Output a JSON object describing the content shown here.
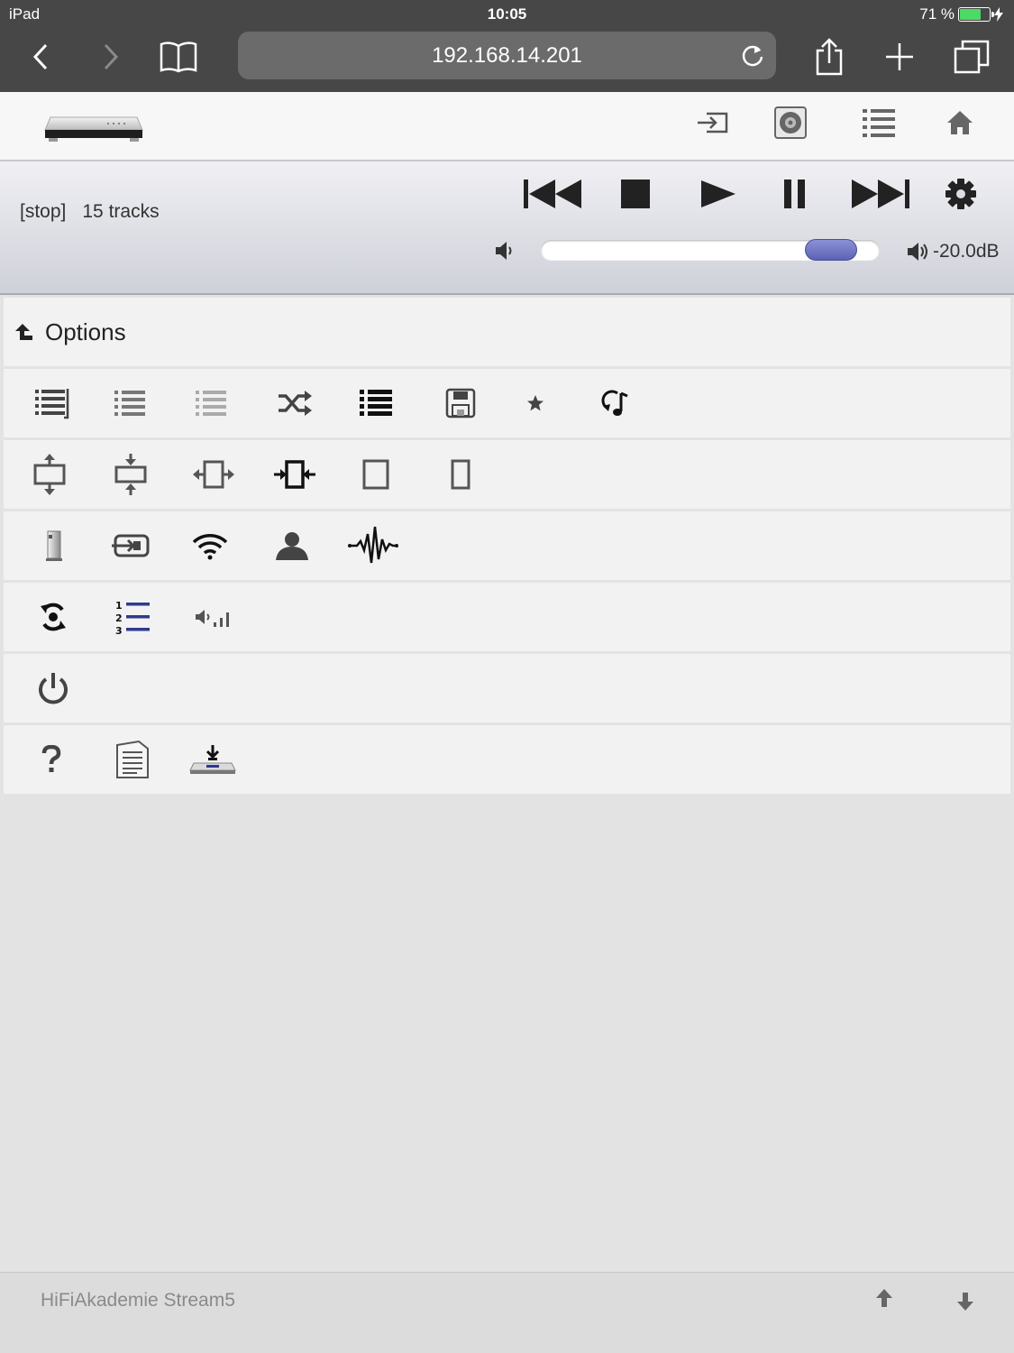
{
  "status_bar": {
    "device": "iPad",
    "time": "10:05",
    "battery": "71 %",
    "battery_level": 0.71
  },
  "safari": {
    "url": "192.168.14.201"
  },
  "player": {
    "state": "[stop]",
    "tracks": "15 tracks",
    "volume_db": "-20.0dB",
    "volume_level": 0.92
  },
  "options": {
    "title": "Options"
  },
  "footer": {
    "title": "HiFiAkademie Stream5"
  },
  "colors": {
    "accent": "#5c63b5",
    "toolbar_bg": "#474747",
    "battery": "#4cd964"
  },
  "icons": {
    "safari": [
      "back-icon",
      "forward-icon",
      "bookmarks-icon",
      "reload-icon",
      "share-icon",
      "new-tab-icon",
      "tabs-icon"
    ],
    "app_top": [
      "input-icon",
      "disc-icon",
      "list-icon",
      "home-icon"
    ],
    "player": [
      "previous-icon",
      "stop-icon",
      "play-icon",
      "pause-icon",
      "next-icon",
      "settings-icon"
    ],
    "rows": [
      [
        "playlist-edit-icon",
        "list-icon",
        "list-light-icon",
        "shuffle-icon",
        "list-bold-icon",
        "save-icon",
        "favorite-star-icon",
        "repeat-music-icon"
      ],
      [
        "expand-vertical-icon",
        "compress-vertical-icon",
        "expand-horizontal-icon",
        "compress-horizontal-icon",
        "square-frame-icon",
        "narrow-frame-icon"
      ],
      [
        "speaker-icon",
        "input-icon",
        "wifi-icon",
        "user-icon",
        "waveform-icon"
      ],
      [
        "sync-icon",
        "numbered-list-icon",
        "volume-steps-icon"
      ],
      [
        "power-icon"
      ],
      [
        "help-icon",
        "document-icon",
        "firmware-download-icon"
      ]
    ]
  }
}
